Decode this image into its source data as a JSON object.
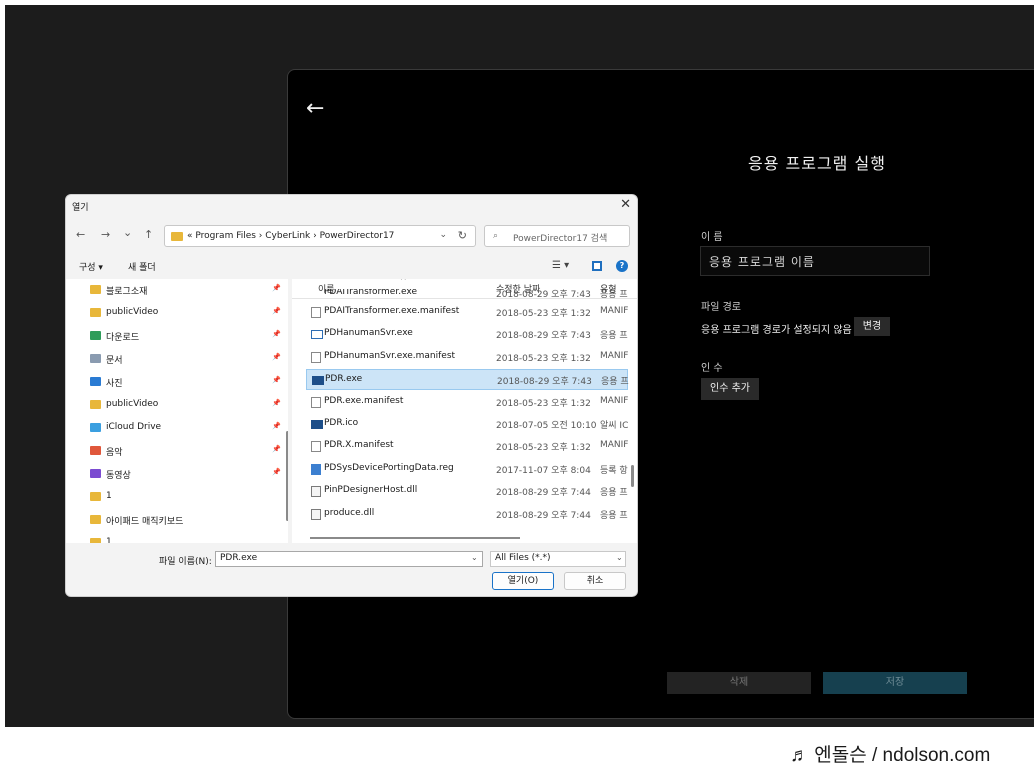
{
  "panel": {
    "back_icon": "back-arrow-icon",
    "title": "응용 프로그램 실행",
    "name_label": "이 름",
    "name_placeholder": "응용 프로그램 이름",
    "path_label": "파일 경로",
    "path_value": "응용 프로그램 경로가 설정되지 않음",
    "change_label": "변경",
    "args_label": "인 수",
    "add_arg_label": "인수 추가",
    "delete_label": "삭제",
    "save_label": "저장"
  },
  "dialog": {
    "title": "열기",
    "close_glyph": "✕",
    "nav": {
      "back": "←",
      "forward": "→",
      "recent": "⌄",
      "up": "↑"
    },
    "address_path": "« Program Files  ›  CyberLink  ›  PowerDirector17",
    "search_placeholder": "PowerDirector17 검색",
    "organize_label": "구성 ▾",
    "new_folder_label": "새 폴더",
    "view_menu": "☰ ▾",
    "sidebar": [
      {
        "label": "블로그소재",
        "icon": "folder-icon",
        "color": "#e8b73a"
      },
      {
        "label": "publicVideo",
        "icon": "folder-icon",
        "color": "#e8b73a"
      },
      {
        "label": "다운로드",
        "icon": "download-icon",
        "color": "#2e9c5a"
      },
      {
        "label": "문서",
        "icon": "document-icon",
        "color": "#8a9bb0"
      },
      {
        "label": "사진",
        "icon": "pictures-icon",
        "color": "#2a7bd3"
      },
      {
        "label": "publicVideo",
        "icon": "folder-icon",
        "color": "#e8b73a"
      },
      {
        "label": "iCloud Drive",
        "icon": "cloud-icon",
        "color": "#3b9fe0"
      },
      {
        "label": "음악",
        "icon": "music-icon",
        "color": "#e0573b"
      },
      {
        "label": "동영상",
        "icon": "video-icon",
        "color": "#7b4bd1"
      },
      {
        "label": "1",
        "icon": "folder-icon",
        "color": "#e8b73a"
      },
      {
        "label": "아이패드 매직키보드",
        "icon": "folder-icon",
        "color": "#e8b73a"
      },
      {
        "label": "1",
        "icon": "folder-icon",
        "color": "#e8b73a"
      }
    ],
    "columns": {
      "name": "이름",
      "date": "수정한 날짜",
      "type": "유형"
    },
    "partial_row": {
      "name": "PDAITransformer.exe",
      "date": "2018-08-29 오후 7:43",
      "type": "응용 프"
    },
    "files": [
      {
        "name": "PDAITransformer.exe.manifest",
        "date": "2018-05-23 오후 1:32",
        "type": "MANIFEST",
        "icon": "file-icon"
      },
      {
        "name": "PDHanumanSvr.exe",
        "date": "2018-08-29 오후 7:43",
        "type": "응용 프로그램",
        "icon": "app-icon"
      },
      {
        "name": "PDHanumanSvr.exe.manifest",
        "date": "2018-05-23 오후 1:32",
        "type": "MANIFEST",
        "icon": "file-icon"
      },
      {
        "name": "PDR.exe",
        "date": "2018-08-29 오후 7:43",
        "type": "응용 프로그램",
        "icon": "exe-icon"
      },
      {
        "name": "PDR.exe.manifest",
        "date": "2018-05-23 오후 1:32",
        "type": "MANIFEST",
        "icon": "file-icon"
      },
      {
        "name": "PDR.ico",
        "date": "2018-07-05 오전 10:10",
        "type": "알씨 ICO",
        "icon": "exe-icon"
      },
      {
        "name": "PDR.X.manifest",
        "date": "2018-05-23 오후 1:32",
        "type": "MANIFEST",
        "icon": "file-icon"
      },
      {
        "name": "PDSysDevicePortingData.reg",
        "date": "2017-11-07 오후 8:04",
        "type": "등록 항목",
        "icon": "reg-icon"
      },
      {
        "name": "PinPDesignerHost.dll",
        "date": "2018-08-29 오후 7:44",
        "type": "응용 프로그램",
        "icon": "dll-icon"
      },
      {
        "name": "produce.dll",
        "date": "2018-08-29 오후 7:44",
        "type": "응용 프로그램",
        "icon": "dll-icon"
      }
    ],
    "selected_file": "PDR.exe",
    "filename_label": "파일 이름(N):",
    "filename_value": "PDR.exe",
    "filter_value": "All Files (*.*)",
    "open_label": "열기(O)",
    "cancel_label": "취소"
  },
  "watermark": "♬ 엔돌슨 / ndolson.com"
}
